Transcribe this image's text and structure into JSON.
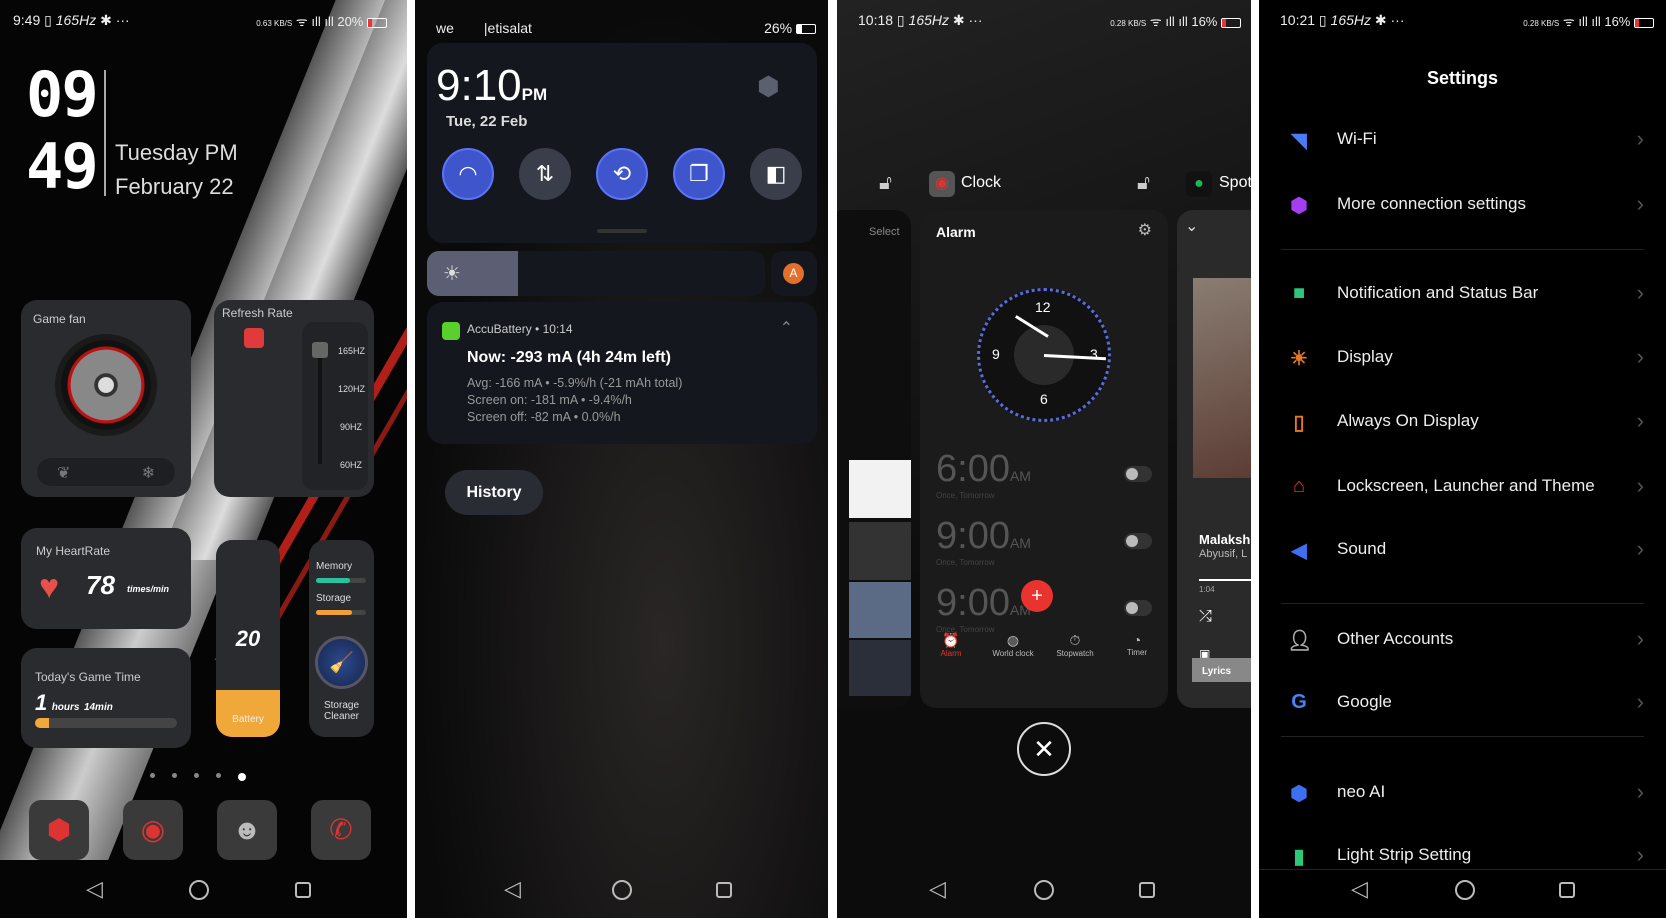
{
  "home": {
    "status": {
      "time": "9:49",
      "hz": "165Hz",
      "speed": "0.63 KB/S",
      "battery": "20%"
    },
    "clock": {
      "hour": "09",
      "minute": "49",
      "day": "Tuesday PM",
      "date": "February 22"
    },
    "game_fan": {
      "title": "Game fan"
    },
    "refresh_rate": {
      "title": "Refresh Rate",
      "options": [
        "165HZ",
        "120HZ",
        "90HZ",
        "60HZ"
      ],
      "selected": "165HZ"
    },
    "heart": {
      "title": "My HeartRate",
      "value": "78",
      "unit": "times/min"
    },
    "game_time": {
      "title": "Today's Game Time",
      "hours": "1",
      "hours_unit": "hours",
      "minutes": "14min",
      "progress": 0.1
    },
    "battery": {
      "value": "20",
      "label": "Battery"
    },
    "memory": {
      "label": "Memory",
      "fill": 0.68
    },
    "storage": {
      "label": "Storage",
      "fill": 0.72
    },
    "cleaner": {
      "label": "Storage Cleaner"
    },
    "page_dots": 5,
    "active_dot": 5,
    "dock": [
      "game-space-icon",
      "camera-icon",
      "avatar-app-icon",
      "phone-icon"
    ]
  },
  "shade": {
    "status": {
      "carrier1": "we",
      "carrier2": "etisalat",
      "battery": "26%"
    },
    "time": "9:10",
    "ampm": "PM",
    "date": "Tue, 22 Feb",
    "toggles": [
      {
        "icon": "wifi-icon",
        "on": true
      },
      {
        "icon": "mobile-data-icon",
        "on": false
      },
      {
        "icon": "auto-rotate-icon",
        "on": true
      },
      {
        "icon": "copy-icon",
        "on": true
      },
      {
        "icon": "split-screen-icon",
        "on": false
      }
    ],
    "brightness": 0.27,
    "auto_brightness": "A",
    "notification": {
      "app": "AccuBattery",
      "time": "10:14",
      "title": "Now: -293 mA (4h 24m left)",
      "lines": [
        "Avg: -166 mA • -5.9%/h (-21 mAh total)",
        "Screen on: -181 mA • -9.4%/h",
        "Screen off: -82 mA • 0.0%/h"
      ]
    },
    "history": "History"
  },
  "recents": {
    "status": {
      "time": "10:18",
      "hz": "165Hz",
      "speed": "0.28 KB/S",
      "battery": "16%"
    },
    "apps": [
      {
        "name": "Clock"
      },
      {
        "name": "Spot"
      }
    ],
    "select": "Select",
    "clock_app": {
      "title": "Alarm",
      "dial": [
        "12",
        "3",
        "6",
        "9"
      ],
      "alarms": [
        {
          "time": "6:00",
          "ampm": "AM",
          "sub": "Once, Tomorrow"
        },
        {
          "time": "9:00",
          "ampm": "AM",
          "sub": "Once, Tomorrow"
        },
        {
          "time": "9:00",
          "ampm": "AM",
          "sub": "Once, Tomorrow"
        }
      ],
      "tabs": [
        "Alarm",
        "World clock",
        "Stopwatch",
        "Timer"
      ],
      "active_tab": "Alarm"
    },
    "spotify": {
      "song": "Malaksh",
      "artist": "Abyusif, L",
      "elapsed": "1:04",
      "lyrics": "Lyrics"
    }
  },
  "settings": {
    "status": {
      "time": "10:21",
      "hz": "165Hz",
      "speed": "0.28 KB/S",
      "battery": "16%"
    },
    "title": "Settings",
    "items": [
      {
        "label": "Wi-Fi",
        "icon": "wifi-icon",
        "color": "#4a7cf5"
      },
      {
        "label": "More connection settings",
        "icon": "connection-icon",
        "color": "#a53ef0"
      },
      {
        "label": "Notification and Status Bar",
        "icon": "notification-icon",
        "color": "#2ec77a"
      },
      {
        "label": "Display",
        "icon": "sun-icon",
        "color": "#e8772a"
      },
      {
        "label": "Always On Display",
        "icon": "aod-icon",
        "color": "#e8772a"
      },
      {
        "label": "Lockscreen, Launcher and Theme",
        "icon": "home-icon",
        "color": "#e8362f"
      },
      {
        "label": "Sound",
        "icon": "speaker-icon",
        "color": "#3d6ff0"
      },
      {
        "label": "Other Accounts",
        "icon": "person-icon",
        "color": "#aaaaaa"
      },
      {
        "label": "Google",
        "icon": "google-icon",
        "color": "#4285f4"
      },
      {
        "label": "neo AI",
        "icon": "ai-icon",
        "color": "#3d6ff0",
        "badge": "AI"
      },
      {
        "label": "Light Strip Setting",
        "icon": "light-strip-icon",
        "color": "#2ec77a"
      }
    ]
  }
}
